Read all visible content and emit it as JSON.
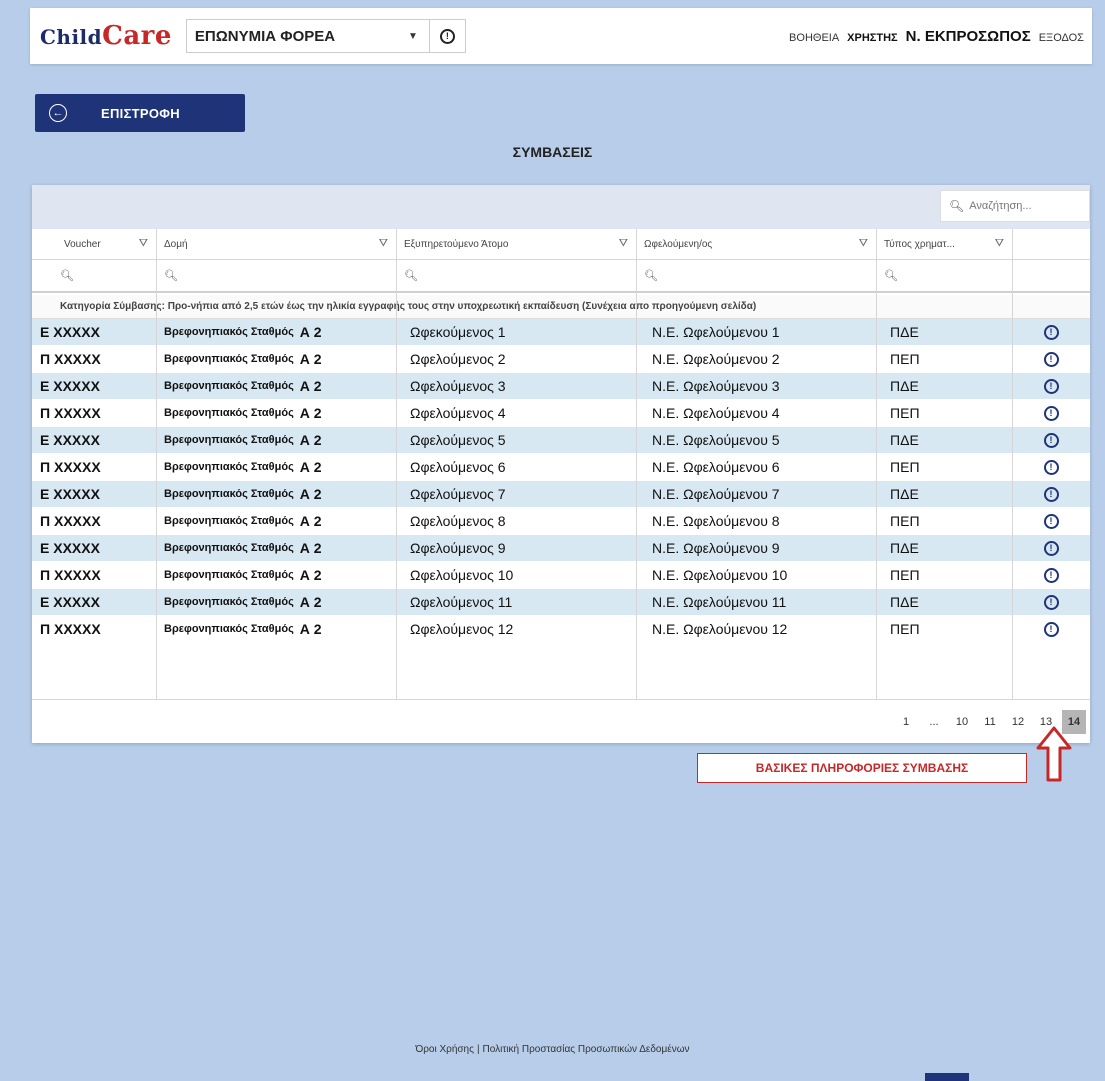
{
  "header": {
    "logo_part1": "Child",
    "logo_part2": "Care",
    "org_select_value": "ΕΠΩΝΥΜΙΑ ΦΟΡΕΑ",
    "help": "ΒΟΗΘΕΙΑ",
    "user": "ΧΡΗΣΤΗΣ",
    "representative": "Ν. ΕΚΠΡΟΣΩΠΟΣ",
    "logout": "ΕΞΟΔΟΣ"
  },
  "back_button": {
    "label": "ΕΠΙΣΤΡΟΦΗ"
  },
  "page_title": "ΣΥΜΒΑΣΕΙΣ",
  "search": {
    "placeholder": "Αναζήτηση..."
  },
  "table": {
    "columns": [
      "Voucher",
      "Δομή",
      "Εξυπηρετούμενο Άτομο",
      "Ωφελούμενη/ος",
      "Τύπος χρηματ..."
    ],
    "category": "Κατηγορία Σύμβασης: Προ-νήπια από 2,5 ετών έως την ηλικία εγγραφής τους στην υποχρεωτική εκπαίδευση (Συνέχεια απο προηγούμενη σελίδα)",
    "rows": [
      {
        "voucher": "Ε ΧΧΧΧΧ",
        "dom": "Βρεφονηπιακός Σταθμός",
        "grade": "Α 2",
        "person": "Ωφεκούμενος 1",
        "beneficiary": "Ν.Ε. Ωφελούμενου 1",
        "type": "ΠΔΕ"
      },
      {
        "voucher": "Π ΧΧΧΧΧ",
        "dom": "Βρεφονηπιακός Σταθμός",
        "grade": "Α 2",
        "person": "Ωφελούμενος 2",
        "beneficiary": "Ν.Ε. Ωφελούμενου 2",
        "type": "ΠΕΠ"
      },
      {
        "voucher": "Ε ΧΧΧΧΧ",
        "dom": "Βρεφονηπιακός Σταθμός",
        "grade": "Α 2",
        "person": "Ωφελούμενος 3",
        "beneficiary": "Ν.Ε. Ωφελούμενου 3",
        "type": "ΠΔΕ"
      },
      {
        "voucher": "Π ΧΧΧΧΧ",
        "dom": "Βρεφονηπιακός Σταθμός",
        "grade": "Α 2",
        "person": "Ωφελούμενος 4",
        "beneficiary": "Ν.Ε. Ωφελούμενου 4",
        "type": "ΠΕΠ"
      },
      {
        "voucher": "Ε ΧΧΧΧΧ",
        "dom": "Βρεφονηπιακός Σταθμός",
        "grade": "Α 2",
        "person": "Ωφελούμενος 5",
        "beneficiary": "Ν.Ε. Ωφελούμενου 5",
        "type": "ΠΔΕ"
      },
      {
        "voucher": "Π ΧΧΧΧΧ",
        "dom": "Βρεφονηπιακός Σταθμός",
        "grade": "Α 2",
        "person": "Ωφελούμενος 6",
        "beneficiary": "Ν.Ε. Ωφελούμενου 6",
        "type": "ΠΕΠ"
      },
      {
        "voucher": "Ε ΧΧΧΧΧ",
        "dom": "Βρεφονηπιακός Σταθμός",
        "grade": "Α 2",
        "person": "Ωφελούμενος 7",
        "beneficiary": "Ν.Ε. Ωφελούμενου 7",
        "type": "ΠΔΕ"
      },
      {
        "voucher": "Π ΧΧΧΧΧ",
        "dom": "Βρεφονηπιακός Σταθμός",
        "grade": "Α 2",
        "person": "Ωφελούμενος 8",
        "beneficiary": "Ν.Ε. Ωφελούμενου 8",
        "type": "ΠΕΠ"
      },
      {
        "voucher": "Ε ΧΧΧΧΧ",
        "dom": "Βρεφονηπιακός Σταθμός",
        "grade": "Α 2",
        "person": "Ωφελούμενος 9",
        "beneficiary": "Ν.Ε. Ωφελούμενου 9",
        "type": "ΠΔΕ"
      },
      {
        "voucher": "Π ΧΧΧΧΧ",
        "dom": "Βρεφονηπιακός Σταθμός",
        "grade": "Α 2",
        "person": "Ωφελούμενος 10",
        "beneficiary": "Ν.Ε. Ωφελούμενου 10",
        "type": "ΠΕΠ"
      },
      {
        "voucher": "Ε ΧΧΧΧΧ",
        "dom": "Βρεφονηπιακός Σταθμός",
        "grade": "Α 2",
        "person": "Ωφελούμενος 11",
        "beneficiary": "Ν.Ε. Ωφελούμενου 11",
        "type": "ΠΔΕ"
      },
      {
        "voucher": "Π ΧΧΧΧΧ",
        "dom": "Βρεφονηπιακός Σταθμός",
        "grade": "Α 2",
        "person": "Ωφελούμενος 12",
        "beneficiary": "Ν.Ε. Ωφελούμενου 12",
        "type": "ΠΕΠ"
      }
    ]
  },
  "pagination": {
    "first": "1",
    "ellipsis": "...",
    "pages": [
      "10",
      "11",
      "12",
      "13"
    ],
    "current": "14"
  },
  "annotation": "ΒΑΣΙΚΕΣ ΠΛΗΡΟΦΟΡΙΕΣ ΣΥΜΒΑΣΗΣ",
  "footer": {
    "terms": "Όροι Χρήσης",
    "separator": "|",
    "privacy": "Πολιτική Προστασίας Προσωπικών Δεδομένων"
  },
  "colors": {
    "background": "#b7cde9",
    "primary": "#1f3378",
    "accent_red": "#c62828",
    "row_blue": "#d7e8f3"
  },
  "icons": {
    "info": "info-circle-icon",
    "filter": "funnel-icon",
    "search": "magnifier-icon",
    "back": "arrow-left-circle-icon",
    "dropdown": "caret-down-icon",
    "annotation_arrow": "arrow-up-icon"
  }
}
